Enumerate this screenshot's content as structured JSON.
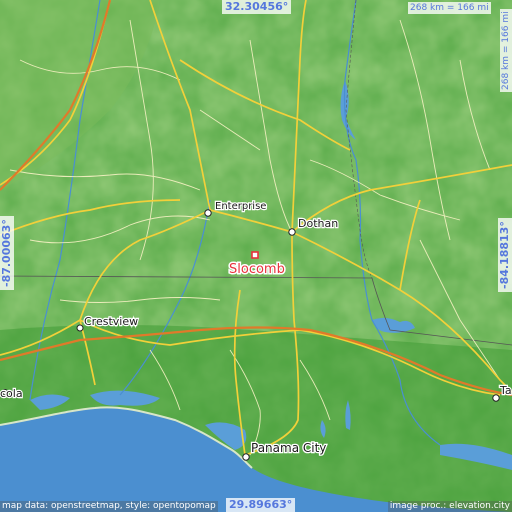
{
  "map": {
    "place": "Slocomb",
    "colors": {
      "land_low": "#3f9a35",
      "land_mid": "#6bb451",
      "land_high": "#8fc266",
      "water": "#5a9ed8",
      "sea": "#4b8fd0",
      "road_major": "#f2d03a",
      "road_minor": "#f7f2c4",
      "highlight": "#e8323c",
      "coord_text": "#5577dd"
    }
  },
  "coords": {
    "north": "32.30456°",
    "south": "29.89663°",
    "west": "-87.00063°",
    "east": "-84.18813°"
  },
  "scale": {
    "horizontal": "268 km = 166 mi",
    "vertical": "268 km = 166 mi"
  },
  "cities": {
    "enterprise": "Enterprise",
    "dothan": "Dothan",
    "slocomb": "Slocomb",
    "crestview": "Crestview",
    "pensacola": "cola",
    "panama_city": "Panama City",
    "tallahassee": "Ta"
  },
  "attribution": {
    "left": "map data: openstreetmap, style: opentopomap",
    "right": "image proc.: elevation.city"
  }
}
